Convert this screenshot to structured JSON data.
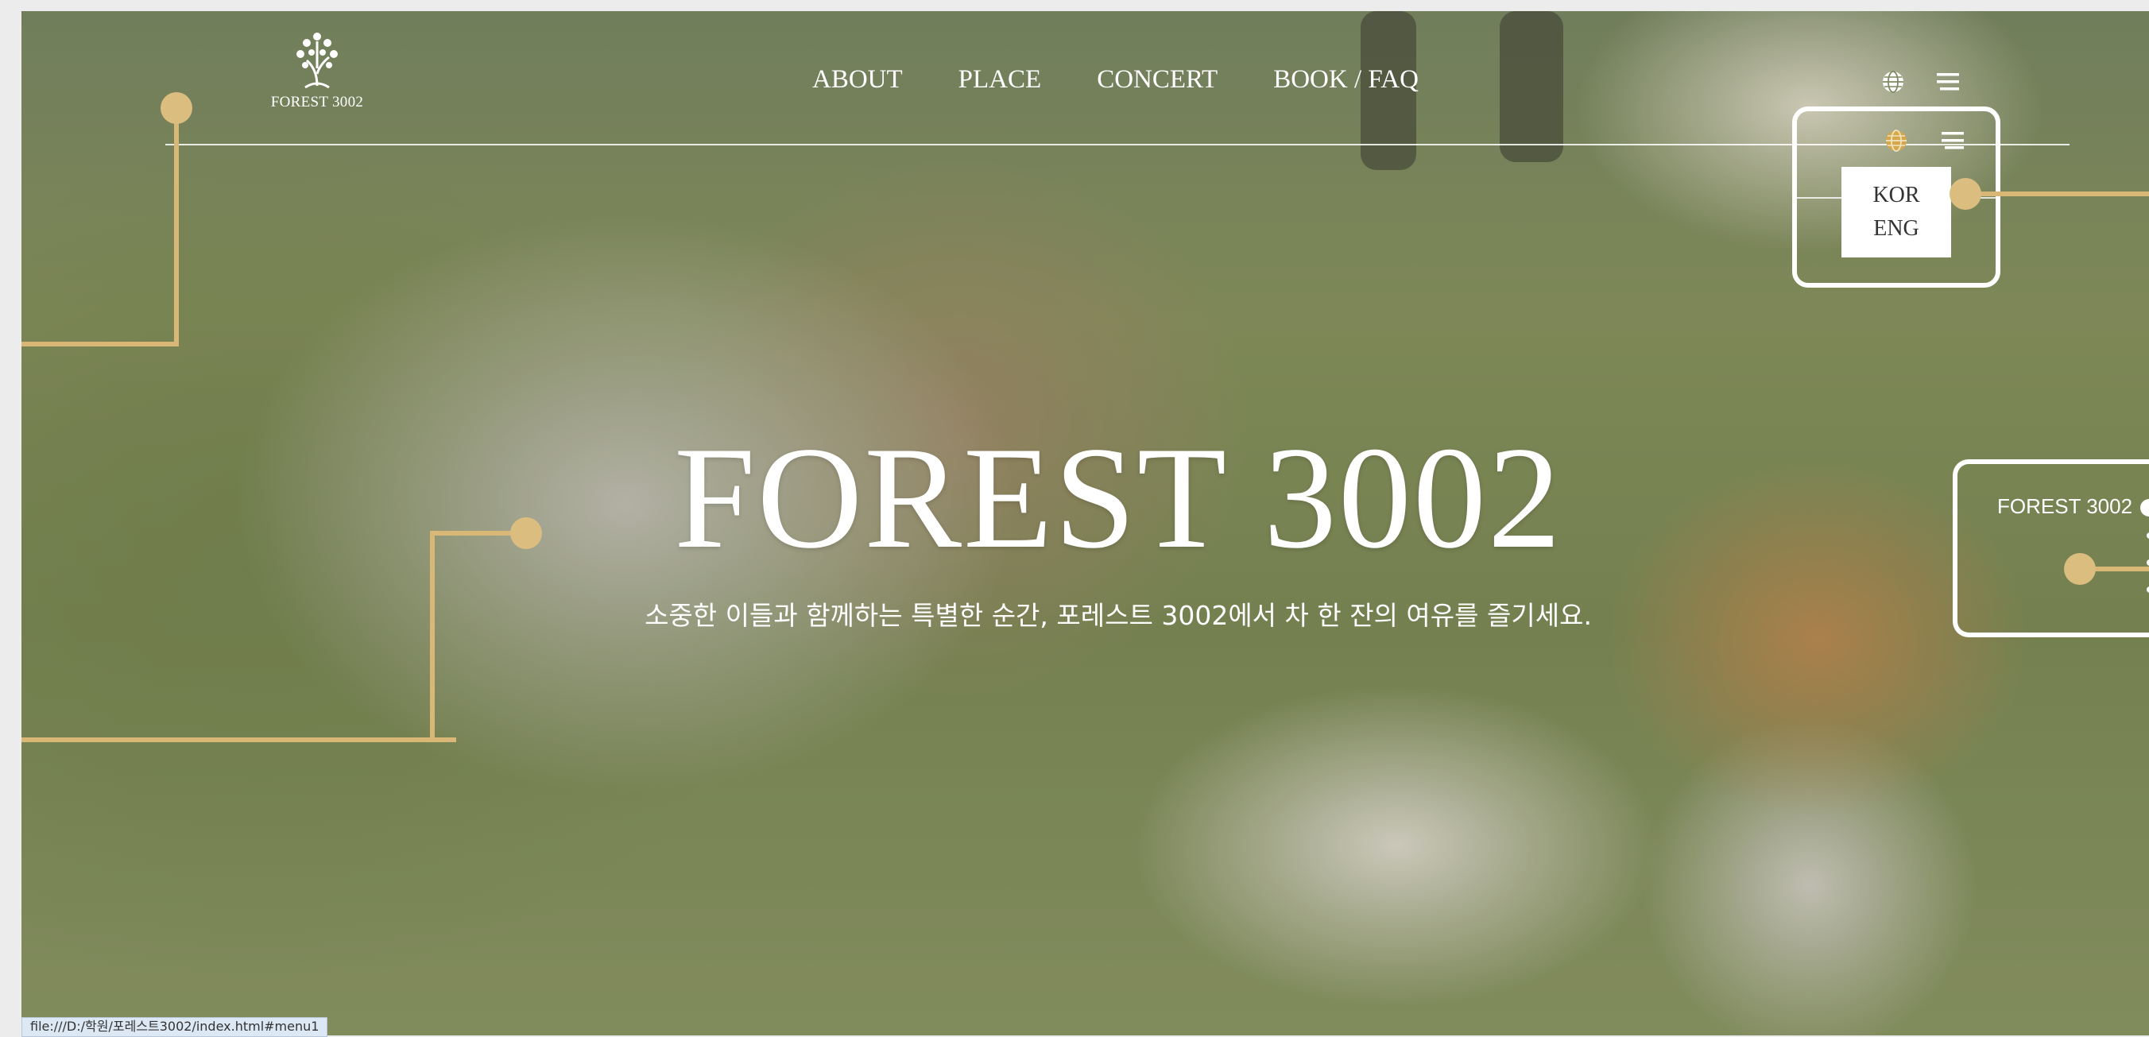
{
  "site": {
    "logo_text": "FOREST 3002"
  },
  "nav": {
    "items": [
      {
        "label": "ABOUT"
      },
      {
        "label": "PLACE"
      },
      {
        "label": "CONCERT"
      },
      {
        "label": "BOOK / FAQ"
      }
    ]
  },
  "hero": {
    "title": "FOREST 3002",
    "subtitle": "소중한 이들과 함께하는 특별한 순간, 포레스트 3002에서 차 한 잔의 여유를 즐기세요."
  },
  "language_menu": {
    "options": [
      "KOR",
      "ENG"
    ]
  },
  "side_nav": {
    "label": "FOREST 3002"
  },
  "status_bar": {
    "url": "file:///D:/학원/포레스트3002/index.html#menu1"
  },
  "colors": {
    "accent_gold": "#dcbd80",
    "globe_active": "#d4a84a",
    "white": "#ffffff"
  },
  "icons": [
    "logo-tree-icon",
    "globe-icon",
    "hamburger-menu-icon"
  ]
}
